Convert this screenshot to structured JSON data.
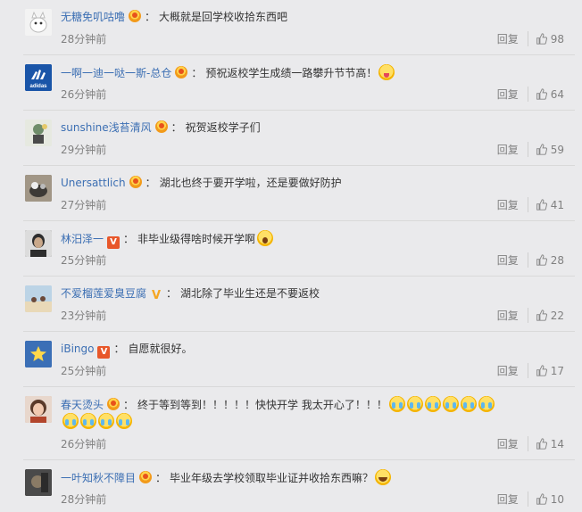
{
  "comments": [
    {
      "user": "无糖免叽咕噜",
      "name_color": "blue",
      "badge": "crown",
      "text": "大概就是回学校收拾东西吧",
      "emojis": [],
      "time": "28分钟前",
      "reply": "回复",
      "likes": "98",
      "avatar": {
        "bg": "#f3f3f3",
        "fg": "#888",
        "label": "🐕"
      }
    },
    {
      "user": "一啊一迪一哒一斯-总仓",
      "name_color": "blue",
      "badge": "crown",
      "text": "预祝返校学生成绩一路攀升节节高！",
      "emojis": [
        "tongue"
      ],
      "time": "26分钟前",
      "reply": "回复",
      "likes": "64",
      "avatar": {
        "bg": "#1a55a8",
        "fg": "#fff",
        "label": "adidas"
      }
    },
    {
      "user": "sunshine浅苔清风",
      "name_color": "blue",
      "badge": "crown",
      "text": "祝贺返校学子们",
      "emojis": [],
      "time": "29分钟前",
      "reply": "回复",
      "likes": "59",
      "avatar": {
        "bg": "#dfe3d8",
        "fg": "#6b6b6b",
        "label": ""
      }
    },
    {
      "user": "Unersattlich",
      "name_color": "blue",
      "badge": "crown",
      "text": "湖北也终于要开学啦，还是要做好防护",
      "emojis": [],
      "time": "27分钟前",
      "reply": "回复",
      "likes": "41",
      "avatar": {
        "bg": "#8a7f6f",
        "fg": "#fff",
        "label": ""
      }
    },
    {
      "user": "林汨泽一",
      "name_color": "blue",
      "badge": "vred",
      "text": "非毕业级得啥时候开学啊",
      "emojis": [
        "wow"
      ],
      "time": "25分钟前",
      "reply": "回复",
      "likes": "28",
      "avatar": {
        "bg": "#3a3a3a",
        "fg": "#fff",
        "label": ""
      }
    },
    {
      "user": "不爱榴莲爱臭豆腐",
      "name_color": "blue",
      "badge": "vgold",
      "text": "湖北除了毕业生还是不要返校",
      "emojis": [],
      "time": "23分钟前",
      "reply": "回复",
      "likes": "22",
      "avatar": {
        "bg": "#bcd4e6",
        "fg": "#fff",
        "label": ""
      }
    },
    {
      "user": "iBingo",
      "name_color": "blue",
      "badge": "vred",
      "text": "自愿就很好。",
      "emojis": [],
      "time": "25分钟前",
      "reply": "回复",
      "likes": "17",
      "avatar": {
        "bg": "#3b6fb6",
        "fg": "#ffd84a",
        "label": "★"
      }
    },
    {
      "user": "春天烫头",
      "name_color": "blue",
      "badge": "crown",
      "text": "终于等到等到！！！！！快快开学 我太开心了！！！",
      "emojis": [
        "cry",
        "cry",
        "cry",
        "cry",
        "cry",
        "cry",
        "cry",
        "cry",
        "cry",
        "cry"
      ],
      "time": "26分钟前",
      "reply": "回复",
      "likes": "14",
      "avatar": {
        "bg": "#c9a48b",
        "fg": "#fff",
        "label": ""
      }
    },
    {
      "user": "一叶知秋不障目",
      "name_color": "blue",
      "badge": "crown",
      "text": "毕业年级去学校领取毕业证并收拾东西嘛？",
      "emojis": [
        "laugh"
      ],
      "time": "28分钟前",
      "reply": "回复",
      "likes": "10",
      "avatar": {
        "bg": "#3f3f3f",
        "fg": "#fff",
        "label": ""
      }
    }
  ]
}
